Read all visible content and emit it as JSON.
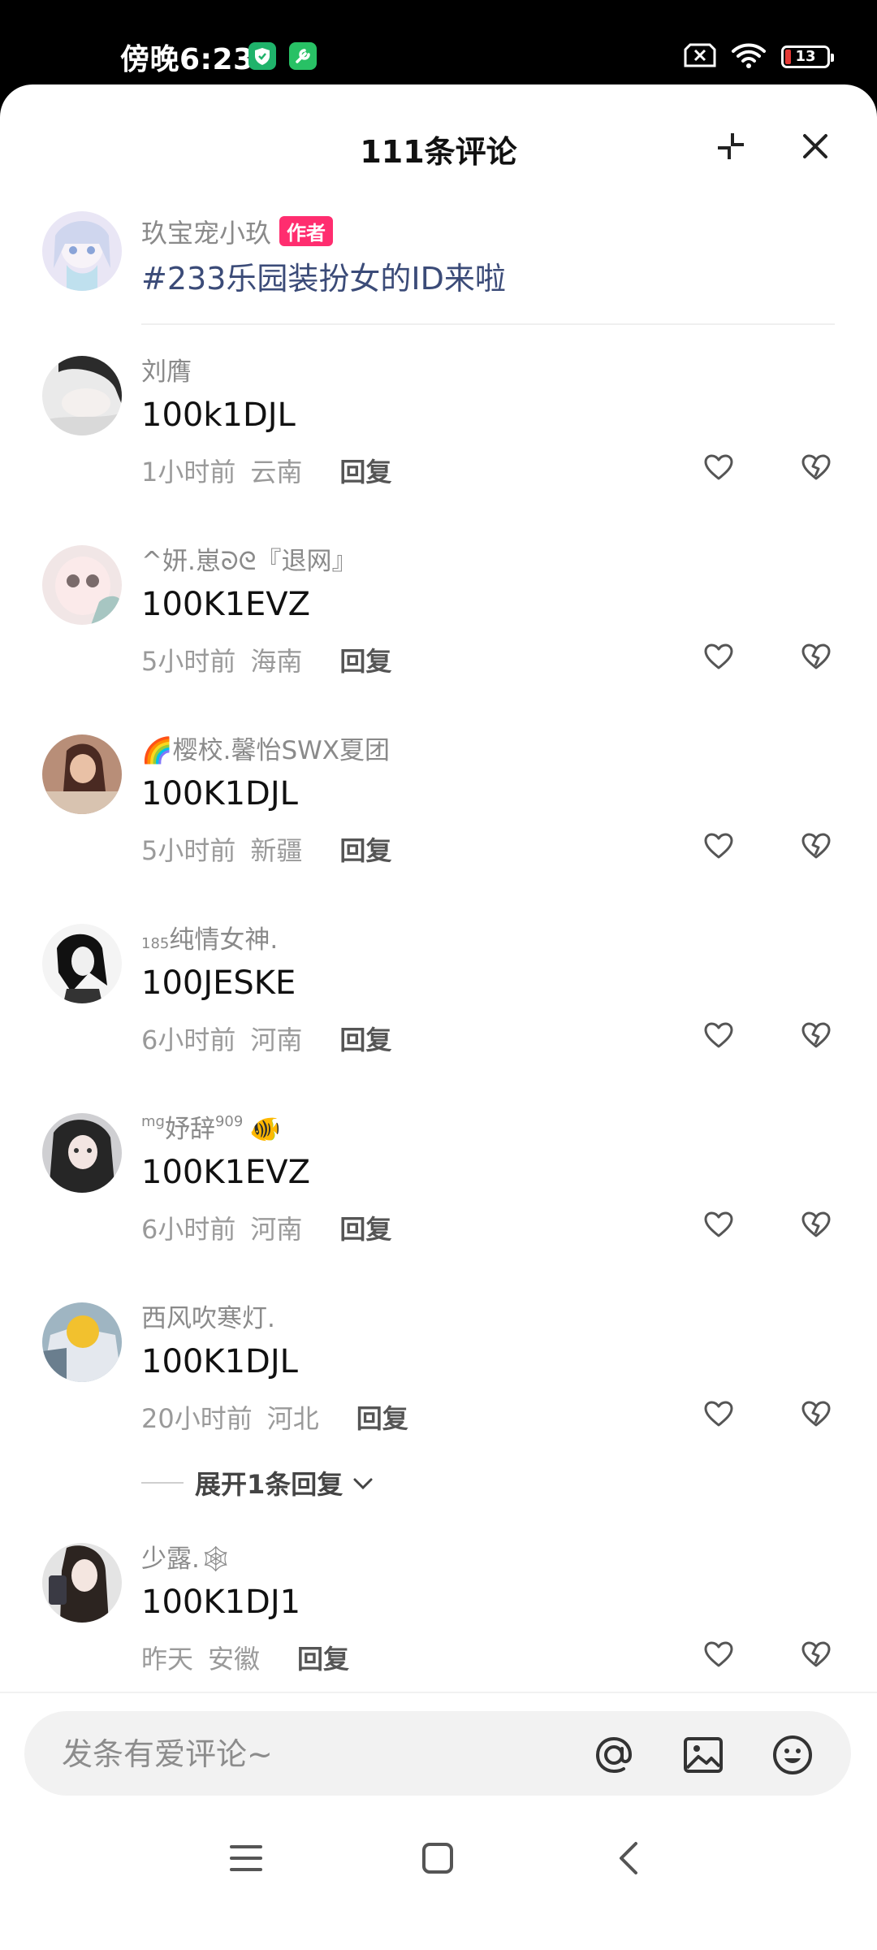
{
  "status_bar": {
    "time": "傍晚6:23",
    "battery": "13",
    "battery_level": 0.13,
    "battery_color": "#e53935"
  },
  "header": {
    "title": "111条评论",
    "collapse_icon": "collapse-icon",
    "close_icon": "close-icon"
  },
  "post": {
    "author": "玖宝宠小玖",
    "author_tag": "作者",
    "text": "#233乐园装扮女的ID来啦",
    "text_color": "#3b4b78"
  },
  "comments": [
    {
      "name": "刘膺",
      "text": "100k1DJL",
      "time": "1小时前",
      "location": "云南",
      "reply": "回复"
    },
    {
      "name": "^妍.崽ᘐᘓ『退网』",
      "text": "100K1EVZ",
      "time": "5小时前",
      "location": "海南",
      "reply": "回复"
    },
    {
      "name": "樱校.馨怡SWX夏团",
      "name_emoji": "🌈",
      "text": "100K1DJL",
      "time": "5小时前",
      "location": "新疆",
      "reply": "回复"
    },
    {
      "name_prefix": "185",
      "name": "纯情女神.",
      "text": "100JESKE",
      "time": "6小时前",
      "location": "河南",
      "reply": "回复"
    },
    {
      "name_prefix": "mg",
      "name": "妤辞",
      "name_suffix": "909",
      "name_emoji": "🐠",
      "text": "100K1EVZ",
      "time": "6小时前",
      "location": "河南",
      "reply": "回复"
    },
    {
      "name": "西风吹寒灯.",
      "text": "100K1DJL",
      "time": "20小时前",
      "location": "河北",
      "reply": "回复"
    },
    {
      "name": "少露.",
      "name_emoji": "🕸",
      "text": "100K1DJ1",
      "time": "昨天",
      "location": "安徽",
      "reply": "回复"
    }
  ],
  "expand_replies": "展开1条回复",
  "input": {
    "placeholder": "发条有爱评论~",
    "icons": [
      "at-icon",
      "image-icon",
      "emoji-icon"
    ]
  },
  "nav_bar": {
    "icons": [
      "menu-icon",
      "home-icon",
      "back-icon"
    ]
  },
  "colors": {
    "author_tag": "#ff2d6f",
    "shield_app": "#1fb36b",
    "tool_app": "#28c165"
  }
}
